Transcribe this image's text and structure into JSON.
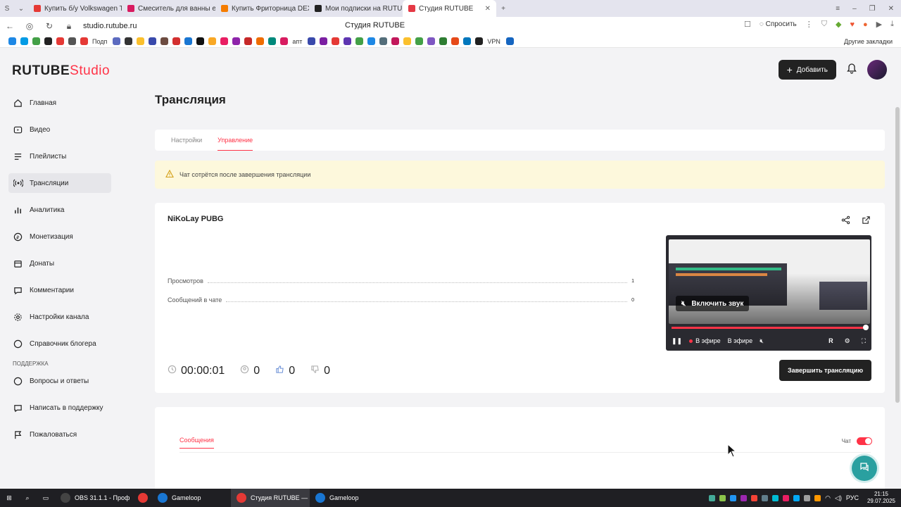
{
  "browser": {
    "tabs": [
      {
        "label": "Купить б/у Volkswagen Ti",
        "color": "#e53935"
      },
      {
        "label": "Смеситель для ванны ed",
        "color": "#d81b60"
      },
      {
        "label": "Купить Фриторница DEX",
        "color": "#f57c00"
      },
      {
        "label": "Мои подписки на RUTUBE",
        "color": "#222222"
      },
      {
        "label": "Студия RUTUBE",
        "color": "#e53945"
      }
    ],
    "url": "studio.rutube.ru",
    "page_title": "Студия RUTUBE",
    "ask_label": "Спросить",
    "bookmarks": {
      "podp_label": "Подп",
      "apt_label": "апт",
      "vpn_label": "VPN",
      "others_label": "Другие закладки"
    }
  },
  "app": {
    "logo": {
      "rutube": "RUTUBE",
      "studio": "Studio"
    },
    "add_button": "Добавить",
    "sidebar": {
      "items": [
        {
          "label": "Главная",
          "icon": "home-icon"
        },
        {
          "label": "Видео",
          "icon": "video-icon"
        },
        {
          "label": "Плейлисты",
          "icon": "playlist-icon"
        },
        {
          "label": "Трансляции",
          "icon": "broadcast-icon",
          "active": true
        },
        {
          "label": "Аналитика",
          "icon": "analytics-icon"
        },
        {
          "label": "Монетизация",
          "icon": "monetization-icon"
        },
        {
          "label": "Донаты",
          "icon": "donate-icon"
        },
        {
          "label": "Комментарии",
          "icon": "comments-icon"
        },
        {
          "label": "Настройки канала",
          "icon": "settings-icon"
        },
        {
          "label": "Справочник блогера",
          "icon": "guide-icon"
        }
      ],
      "support_section": "ПОДДЕРЖКА",
      "support_items": [
        {
          "label": "Вопросы и ответы",
          "icon": "faq-icon"
        },
        {
          "label": "Написать в поддержку",
          "icon": "support-icon"
        },
        {
          "label": "Пожаловаться",
          "icon": "flag-icon"
        }
      ]
    },
    "page_title": "Трансляция",
    "tabs": [
      {
        "label": "Настройки",
        "active": false
      },
      {
        "label": "Управление",
        "active": true
      }
    ],
    "warning_text": "Чат сотрётся после завершения трансляции",
    "stream": {
      "name": "NiKoLay PUBG",
      "stats": [
        {
          "label": "Просмотров",
          "value": "1"
        },
        {
          "label": "Сообщений в чате",
          "value": "0"
        }
      ],
      "duration": "00:00:01",
      "viewers": "0",
      "likes": "0",
      "dislikes": "0",
      "end_button": "Завершить трансляцию"
    },
    "player": {
      "unmute_label": "Включить звук",
      "live_label": "В эфире",
      "live_overlay": "В эфире",
      "progress": 1.0
    },
    "chat": {
      "tab_label": "Сообщения",
      "toggle_label": "Чат",
      "toggle_on": true
    }
  },
  "taskbar": {
    "apps": [
      {
        "label": "OBS 31.1.1 - Проф",
        "color": "#444444",
        "active": false
      },
      {
        "label": "Gameloop",
        "color": "#1976d2",
        "active": false
      },
      {
        "label": "Студия RUTUBE — ...",
        "color": "#e53935",
        "active": true
      },
      {
        "label": "Gameloop",
        "color": "#1976d2",
        "active": false
      }
    ],
    "lang": "РУС",
    "time": "21:15",
    "date": "29.07.2025"
  },
  "colors": {
    "accent": "#ff3347",
    "warning_bg": "#fdf8dc",
    "fab": "#2aa0a0"
  }
}
